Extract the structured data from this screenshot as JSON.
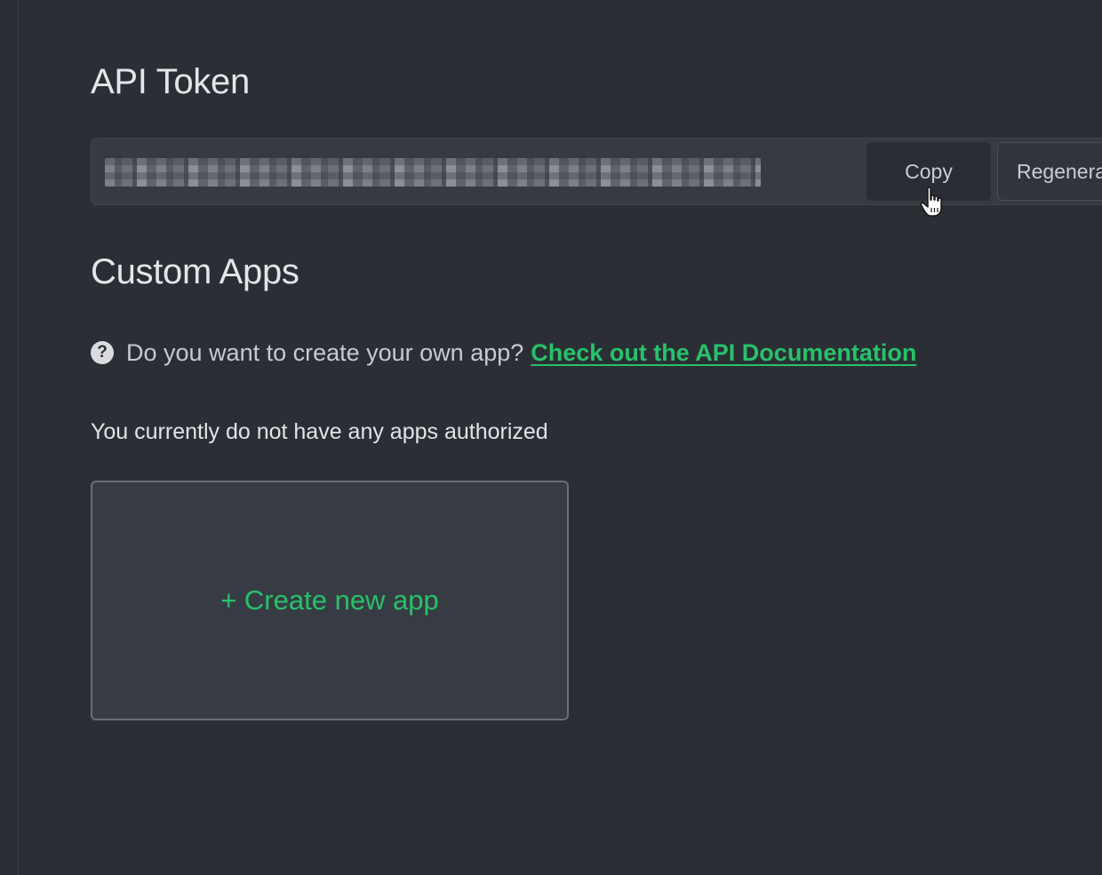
{
  "api_token": {
    "title": "API Token",
    "token_value": "",
    "copy_label": "Copy",
    "regenerate_label": "Regenera"
  },
  "custom_apps": {
    "title": "Custom Apps",
    "help_icon": "question-circle-icon",
    "help_text": "Do you want to create your own app?",
    "docs_link": "Check out the API Documentation",
    "empty_message": "You currently do not have any apps authorized",
    "create_label": "+ Create new app"
  },
  "colors": {
    "background": "#2b2e35",
    "accent": "#27c26a"
  }
}
